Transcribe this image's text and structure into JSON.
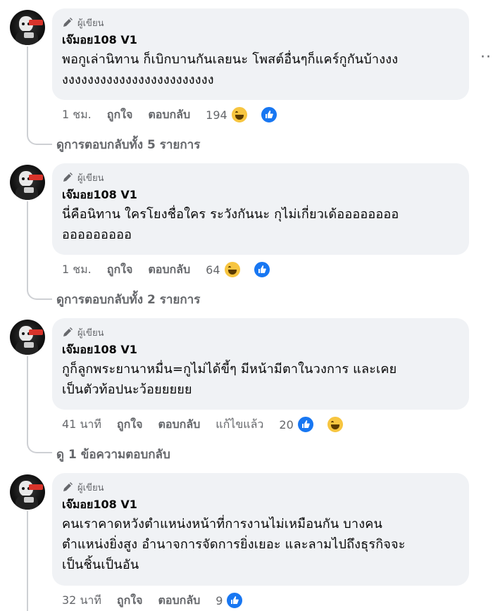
{
  "comments": [
    {
      "author_badge": "ผู้เขียน",
      "name": "เจ๊มอย108 V1",
      "text_line1": "พอกูเล่านิทาน ก็เบิกบานกันเลยนะ โพสต์อื่นๆก็แคร์กูกันบ้างงง",
      "text_line2": "งงงงงงงงงงงงงงงงงงงงงงงง",
      "time": "1 ชม.",
      "like": "ถูกใจ",
      "reply": "ตอบกลับ",
      "edited": "",
      "react_count": "194",
      "reacts": [
        "haha-icon",
        "like-icon"
      ],
      "view_replies": "ดูการตอบกลับทั้ง 5 รายการ"
    },
    {
      "author_badge": "ผู้เขียน",
      "name": "เจ๊มอย108 V1",
      "text_line1": "นี่คือนิทาน ใครโยงชื่อใคร ระวังกันนะ กุไม่เกี่ยวเด้ออออออออ",
      "text_line2": "อออออออออ",
      "time": "1 ชม.",
      "like": "ถูกใจ",
      "reply": "ตอบกลับ",
      "edited": "",
      "react_count": "64",
      "reacts": [
        "haha-icon",
        "like-icon"
      ],
      "view_replies": "ดูการตอบกลับทั้ง 2 รายการ"
    },
    {
      "author_badge": "ผู้เขียน",
      "name": "เจ๊มอย108 V1",
      "text_line1": "กูก็ลูกพระยานาหมื่น=กูไม่ได้ขี้ๆ มีหน้ามีตาในวงการ และเคย",
      "text_line2": "เป็นตัวท้อปนะว้อยยยยย",
      "time": "41 นาที",
      "like": "ถูกใจ",
      "reply": "ตอบกลับ",
      "edited": "แก้ไขแล้ว",
      "react_count": "20",
      "reacts": [
        "like-icon",
        "haha-icon"
      ],
      "view_replies": "ดู 1 ข้อความตอบกลับ"
    },
    {
      "author_badge": "ผู้เขียน",
      "name": "เจ๊มอย108 V1",
      "text_line1": "คนเราคาดหวังตำแหน่งหน้าที่การงานไม่เหมือนกัน บางคน",
      "text_line2": "ตำแหน่งยิ่งสูง อำนาจการจัดการยิ่งเยอะ และลามไปถึงธุรกิจจะ",
      "text_line3": "เป็นชิ้นเป็นอัน",
      "time": "32 นาที",
      "like": "ถูกใจ",
      "reply": "ตอบกลับ",
      "edited": "",
      "react_count": "9",
      "reacts": [
        "like-icon"
      ]
    }
  ],
  "more_options": "···"
}
